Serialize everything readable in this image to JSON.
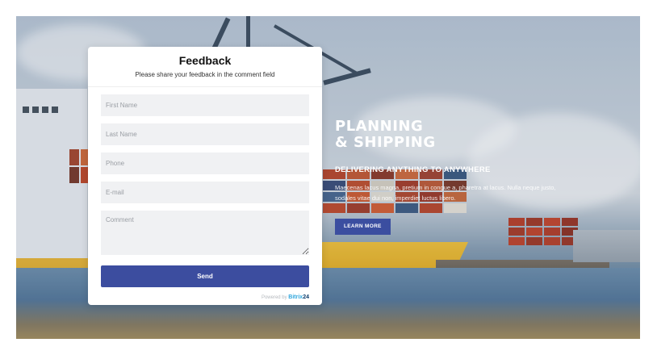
{
  "form": {
    "title": "Feedback",
    "subtitle": "Please share your feedback in the comment field",
    "fields": {
      "first_name": "First Name",
      "last_name": "Last Name",
      "phone": "Phone",
      "email": "E-mail",
      "comment": "Comment"
    },
    "send_label": "Send",
    "powered_prefix": "Powered by",
    "powered_brand": "Bitrix",
    "powered_brand_num": "24"
  },
  "hero": {
    "title": "PLANNING\n& SHIPPING",
    "subtitle": "DELIVERING ANYTHING TO ANYWHERE",
    "body": "Maecenas lacus magna, pretium in congue a, pharetra at lacus. Nulla neque justo, sodales vitae dui non, imperdiet luctus libero.",
    "button_label": "LEARN MORE"
  },
  "colors": {
    "accent": "#3c4d9f",
    "brand_bitrix": "#2fa6dd"
  }
}
